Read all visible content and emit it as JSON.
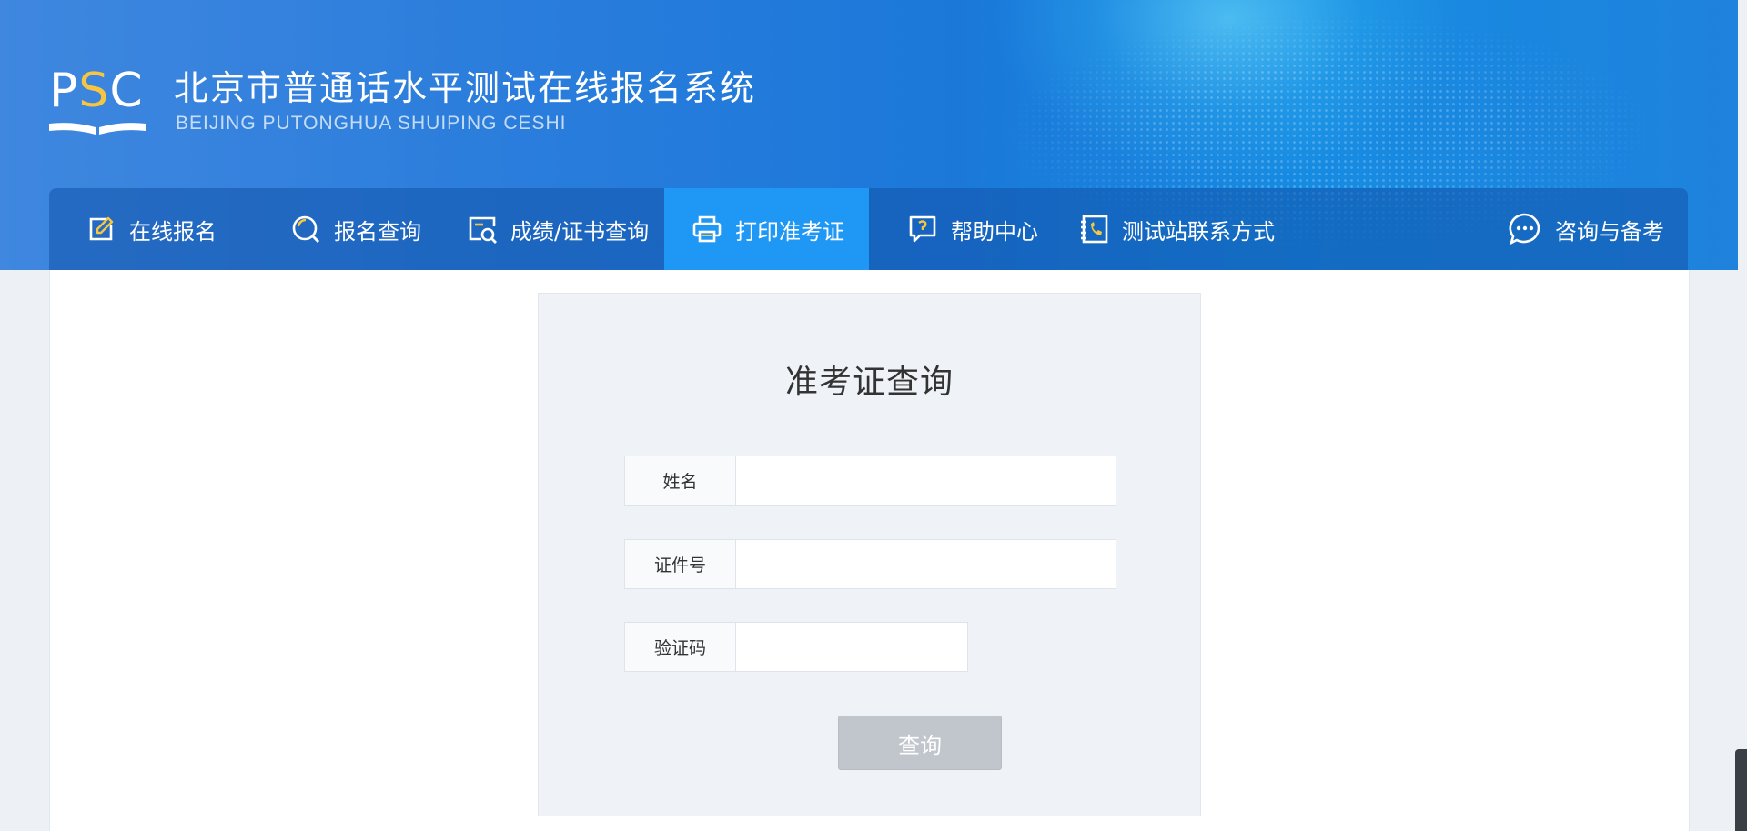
{
  "header": {
    "logo_text_p": "P",
    "logo_text_s": "S",
    "logo_text_c": "C",
    "title": "北京市普通话水平测试在线报名系统",
    "subtitle": "BEIJING PUTONGHUA SHUIPING CESHI"
  },
  "nav": {
    "items": [
      {
        "label": "在线报名",
        "icon": "edit-icon"
      },
      {
        "label": "报名查询",
        "icon": "search-icon"
      },
      {
        "label": "成绩/证书查询",
        "icon": "certificate-search-icon"
      },
      {
        "label": "打印准考证",
        "icon": "printer-icon"
      },
      {
        "label": "帮助中心",
        "icon": "help-icon"
      },
      {
        "label": "测试站联系方式",
        "icon": "contact-book-icon"
      },
      {
        "label": "咨询与备考",
        "icon": "chat-icon"
      }
    ],
    "active_index": 3
  },
  "form": {
    "title": "准考证查询",
    "fields": [
      {
        "label": "姓名",
        "value": "",
        "placeholder": ""
      },
      {
        "label": "证件号",
        "value": "",
        "placeholder": ""
      },
      {
        "label": "验证码",
        "value": "",
        "placeholder": ""
      }
    ],
    "submit_label": "查询"
  },
  "colors": {
    "header_blue": "#1b78d9",
    "nav_active": "#1f97f5",
    "logo_accent": "#f6c542",
    "button_disabled": "#c0c6cc"
  }
}
